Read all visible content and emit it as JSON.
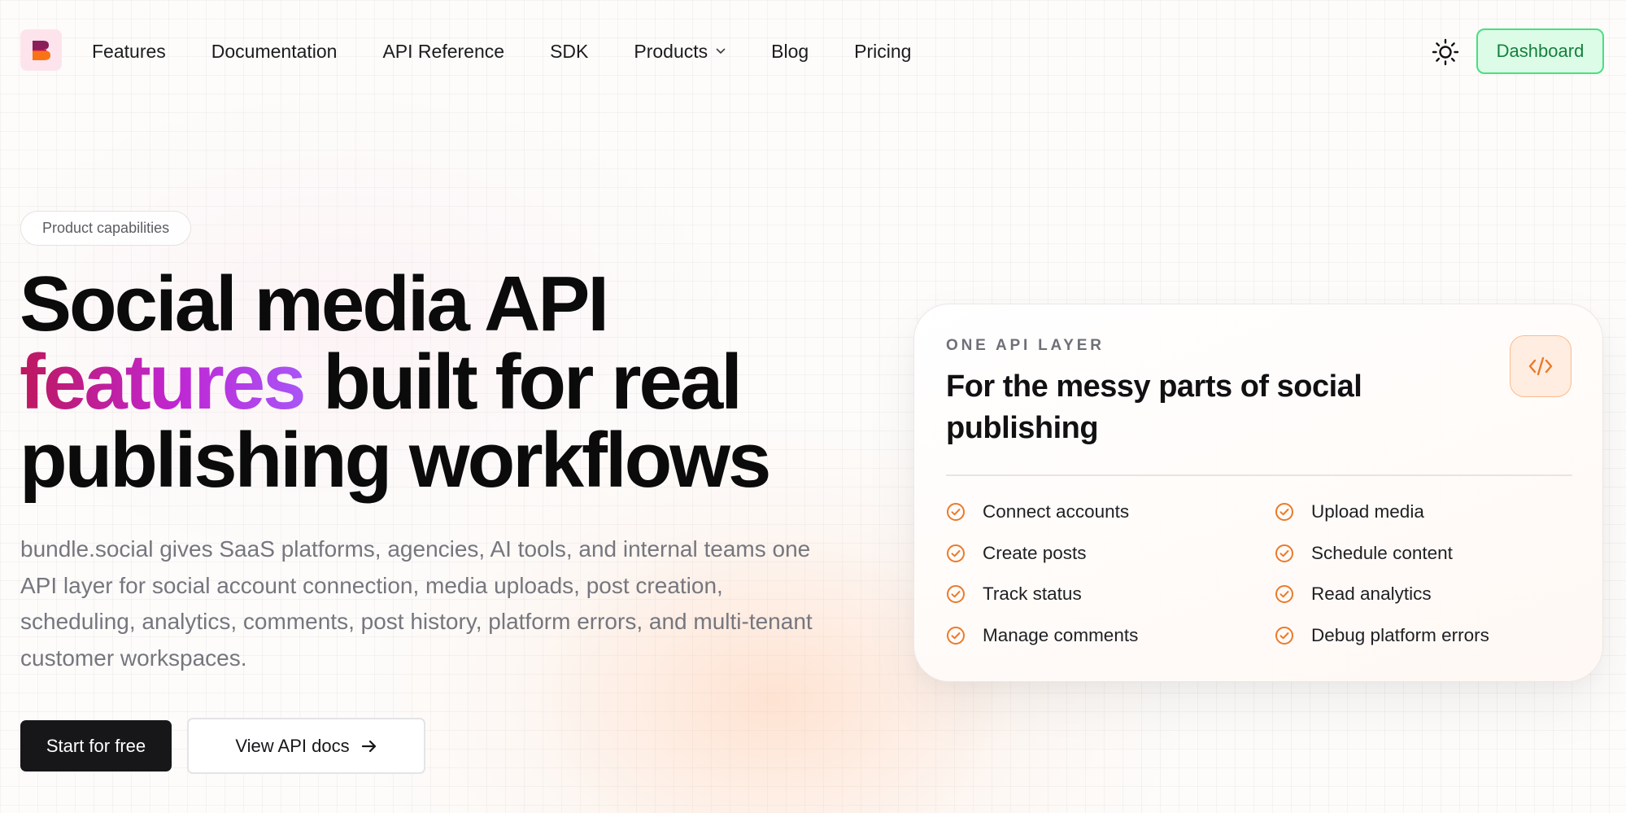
{
  "nav": {
    "logo_letter": "B",
    "links": [
      "Features",
      "Documentation",
      "API Reference",
      "SDK",
      "Products",
      "Blog",
      "Pricing"
    ],
    "theme_icon": "sun-icon",
    "dashboard_label": "Dashboard"
  },
  "hero": {
    "pill": "Product capabilities",
    "headline_line1": "Social media API",
    "headline_highlight": "features",
    "headline_line2_rest": "built for real",
    "headline_line3": "publishing workflows",
    "description": "bundle.social gives SaaS platforms, agencies, AI tools, and internal teams one API layer for social account connection, media uploads, post creation, scheduling, analytics, comments, post history, platform errors, and multi-tenant customer workspaces.",
    "primary_cta": "Start for free",
    "secondary_cta": "View API docs"
  },
  "card": {
    "eyebrow": "ONE API LAYER",
    "title": "For the messy parts of social publishing",
    "icon": "code-icon",
    "features_left": [
      "Connect accounts",
      "Create posts",
      "Track status",
      "Manage comments"
    ],
    "features_right": [
      "Upload media",
      "Schedule content",
      "Read analytics",
      "Debug platform errors"
    ]
  },
  "colors": {
    "accent_green": "#15803d",
    "accent_orange": "#ea7a2a",
    "gradient_start": "#be185d",
    "gradient_end": "#a855f7"
  }
}
